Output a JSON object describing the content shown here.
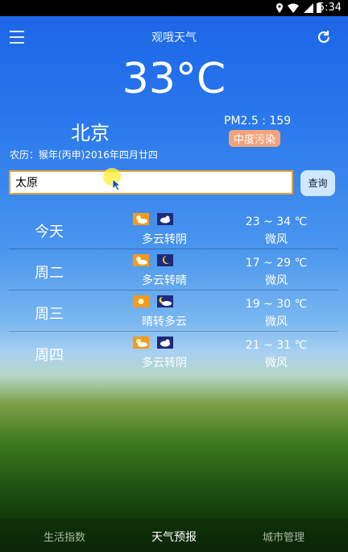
{
  "status_bar": {
    "time": "5:34"
  },
  "header": {
    "title": "观哦天气",
    "menu_icon": "menu-icon",
    "refresh_icon": "refresh-icon"
  },
  "current": {
    "temperature": "33°C",
    "city": "北京",
    "pm25": "PM2.5 : 159",
    "pollution_level": "中度污染",
    "lunar_date": "农历：猴年(丙申)2016年四月廿四"
  },
  "search": {
    "value": "太原",
    "button_label": "查询"
  },
  "forecast": [
    {
      "day": "今天",
      "desc": "多云转阴",
      "range": "23 ~ 34 ℃",
      "wind": "微风",
      "icon1": "cloudy-sun-icon",
      "icon2": "cloud-night-icon"
    },
    {
      "day": "周二",
      "desc": "多云转晴",
      "range": "17 ~ 29 ℃",
      "wind": "微风",
      "icon1": "cloudy-sun-icon",
      "icon2": "moon-icon"
    },
    {
      "day": "周三",
      "desc": "晴转多云",
      "range": "19 ~ 30 ℃",
      "wind": "微风",
      "icon1": "sun-icon",
      "icon2": "cloud-moon-icon"
    },
    {
      "day": "周四",
      "desc": "多云转阴",
      "range": "21 ~ 31 ℃",
      "wind": "微风",
      "icon1": "cloudy-sun-icon",
      "icon2": "cloud-night-icon"
    }
  ],
  "tabs": [
    {
      "label": "生活指数",
      "active": false
    },
    {
      "label": "天气预报",
      "active": true
    },
    {
      "label": "城市管理",
      "active": false
    }
  ],
  "colors": {
    "pollution_badge": "#f0a37c",
    "search_border": "#e8a23a",
    "icon_orange": "#f39a1f",
    "icon_navy": "#1f2b7a"
  }
}
